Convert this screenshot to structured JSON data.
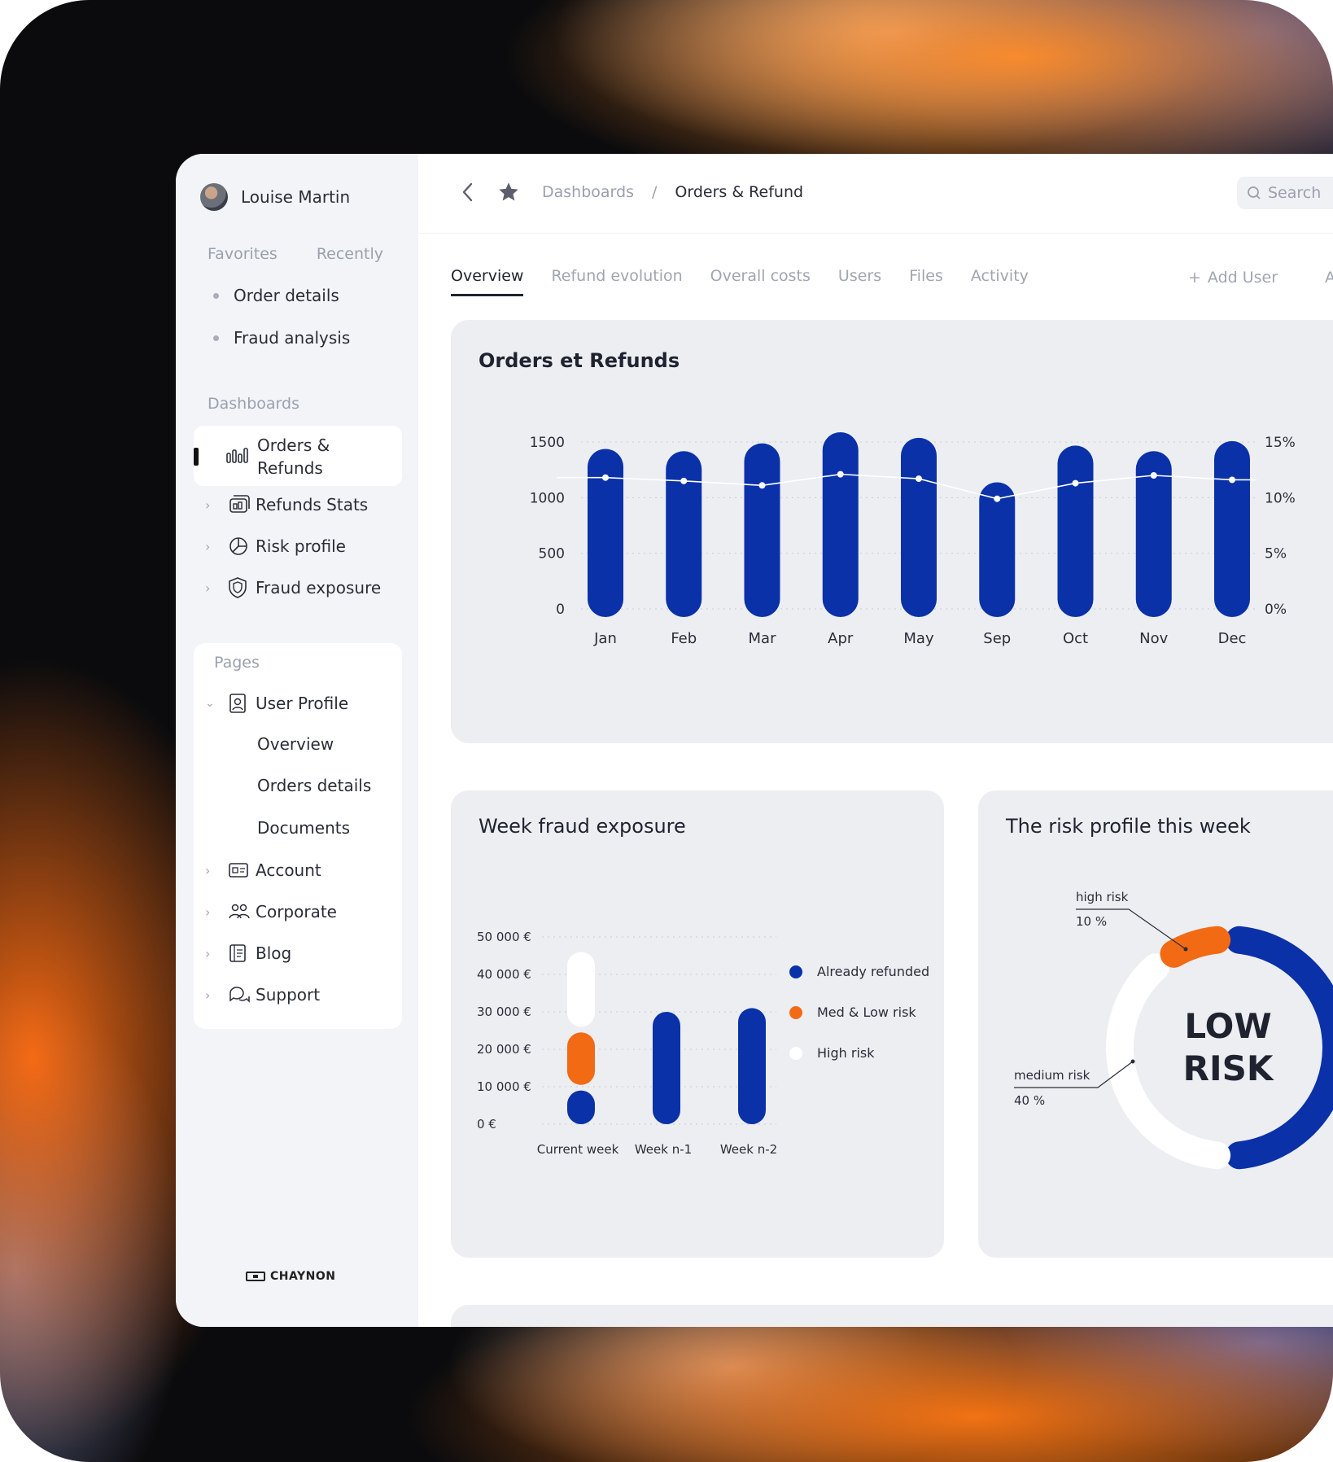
{
  "user": {
    "name": "Louise Martin"
  },
  "sidebar": {
    "fav_tabs": [
      "Favorites",
      "Recently"
    ],
    "favorites": [
      "Order details",
      "Fraud analysis"
    ],
    "dashboards_label": "Dashboards",
    "dash_active": "Orders & Refunds",
    "dash_items": [
      {
        "label": "Refunds Stats",
        "icon": "refunds-stats-icon"
      },
      {
        "label": "Risk profile",
        "icon": "pie-chart-icon"
      },
      {
        "label": "Fraud exposure",
        "icon": "shield-icon"
      }
    ],
    "pages_label": "Pages",
    "user_profile": "User Profile",
    "user_profile_sub": [
      "Overview",
      "Orders details",
      "Documents"
    ],
    "pages_items": [
      {
        "label": "Account",
        "icon": "id-card-icon"
      },
      {
        "label": "Corporate",
        "icon": "people-icon"
      },
      {
        "label": "Blog",
        "icon": "book-icon"
      },
      {
        "label": "Support",
        "icon": "chat-icon"
      }
    ],
    "brand": "CHAYNON"
  },
  "topbar": {
    "crumb_root": "Dashboards",
    "crumb_sep": "/",
    "crumb_current": "Orders & Refund",
    "search_placeholder": "Search"
  },
  "tabs": [
    "Overview",
    "Refund evolution",
    "Overall costs",
    "Users",
    "Files",
    "Activity"
  ],
  "add_user": "Add User",
  "tab_cut": "A",
  "colors": {
    "accent": "#0a31a8",
    "orange": "#f26a14",
    "card": "#eceef2"
  },
  "cards": {
    "orders_title": "Orders et Refunds",
    "fraud_title": "Week fraud exposure",
    "risk_title": "The risk profile this week"
  },
  "chart_data": [
    {
      "type": "bar",
      "title": "Orders et Refunds",
      "categories": [
        "Jan",
        "Feb",
        "Mar",
        "Apr",
        "May",
        "Sep",
        "Oct",
        "Nov",
        "Dec"
      ],
      "series": [
        {
          "values": [
            1350,
            1330,
            1400,
            1500,
            1450,
            1050,
            1380,
            1330,
            1420
          ],
          "axis": "left"
        },
        {
          "values": [
            11.8,
            11.5,
            11.1,
            12.1,
            11.7,
            9.9,
            11.3,
            12.0,
            11.6
          ],
          "axis": "right",
          "kind": "line"
        }
      ],
      "y_ticks": [
        "1500",
        "1000",
        "500",
        "0"
      ],
      "y2_ticks": [
        "15%",
        "10%",
        "5%",
        "0%"
      ],
      "ylim": [
        0,
        1500
      ],
      "y2lim": [
        0,
        15
      ],
      "grid": true
    },
    {
      "type": "bar",
      "title": "Week fraud exposure",
      "categories": [
        "Current week",
        "Week n-1",
        "Week n-2"
      ],
      "series": [
        {
          "name": "Already refunded",
          "values": [
            9000,
            30000,
            31000
          ]
        },
        {
          "name": "Med & Low risk",
          "values": [
            14000,
            0,
            0
          ]
        },
        {
          "name": "High risk",
          "values": [
            20000,
            0,
            0
          ]
        }
      ],
      "y_ticks": [
        "50 000 €",
        "40 000 €",
        "30 000 €",
        "20 000 €",
        "10 000 €",
        "0 €"
      ],
      "ylim": [
        0,
        50000
      ],
      "legend": "right",
      "grid": true
    },
    {
      "type": "pie",
      "title": "The risk profile this week",
      "center_label": [
        "LOW",
        "RISK"
      ],
      "slices": [
        {
          "label": "high risk",
          "value_label": "10 %",
          "value": 10
        },
        {
          "label": "medium risk",
          "value_label": "40 %",
          "value": 40
        },
        {
          "label": "low risk",
          "value": 50
        }
      ]
    }
  ]
}
